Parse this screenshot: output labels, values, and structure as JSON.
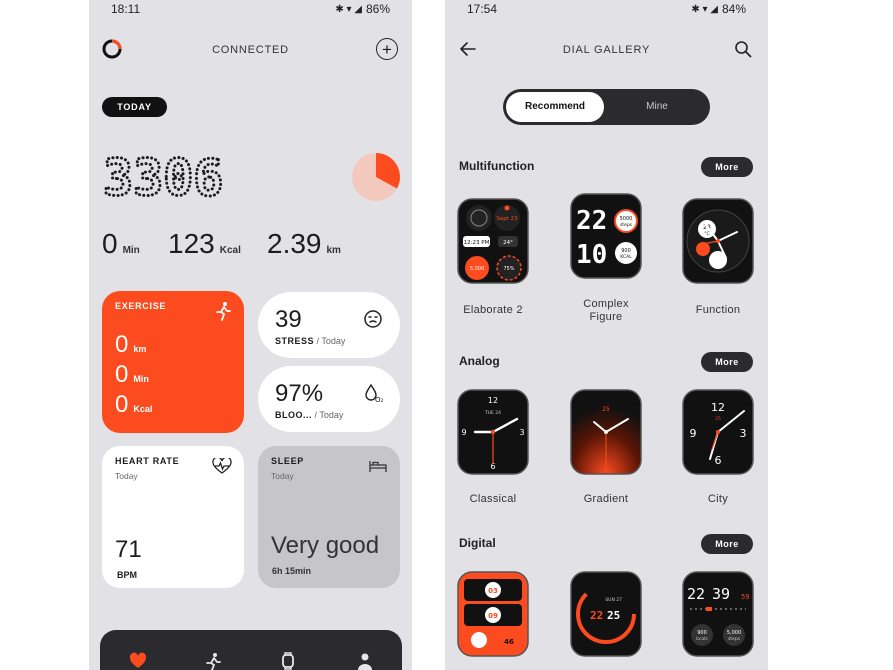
{
  "phone1": {
    "status": {
      "time": "18:11",
      "icons": "✱ ▾ ◢",
      "battery": "86%"
    },
    "header": {
      "title": "CONNECTED"
    },
    "today_chip": "TODAY",
    "steps": "3306",
    "ring_progress": 0.33,
    "metrics": [
      {
        "value": "0",
        "unit": "Min"
      },
      {
        "value": "123",
        "unit": "Kcal"
      },
      {
        "value": "2.39",
        "unit": "km"
      }
    ],
    "exercise": {
      "label": "EXERCISE",
      "rows": [
        {
          "value": "0",
          "unit": "km"
        },
        {
          "value": "0",
          "unit": "Min"
        },
        {
          "value": "0",
          "unit": "Kcal"
        }
      ]
    },
    "stress": {
      "value": "39",
      "label": "STRESS",
      "sub": "/ Today"
    },
    "blood": {
      "value": "97%",
      "label": "BLOO...",
      "sub": "/ Today"
    },
    "heart_rate": {
      "label": "HEART RATE",
      "sub": "Today",
      "value": "71",
      "unit": "BPM"
    },
    "sleep": {
      "label": "SLEEP",
      "sub": "Today",
      "value": "Very good",
      "duration": "6h 15min"
    },
    "nav": [
      "heart-icon",
      "runner-icon",
      "watch-icon",
      "person-icon"
    ],
    "colors": {
      "accent": "#fc4b1f",
      "background": "#e2e1e6",
      "dark": "#2b2b2f"
    }
  },
  "phone2": {
    "status": {
      "time": "17:54",
      "icons": "✱ ▾ ◢",
      "battery": "84%"
    },
    "header": {
      "title": "DIAL GALLERY"
    },
    "tabs": {
      "active": "Recommend",
      "inactive": "Mine"
    },
    "sections": [
      {
        "title": "Multifunction",
        "more": "More",
        "watches": [
          {
            "name": "Elaborate 2",
            "texts": [
              "12:23 PM",
              "24°",
              "5,000",
              "75%",
              "8",
              "Sept 23"
            ]
          },
          {
            "name": "Complex\nFigure",
            "texts": [
              "22",
              "10",
              "5000",
              "steps",
              "900",
              "KCAL"
            ]
          },
          {
            "name": "Function",
            "texts": [
              "28",
              "°C"
            ]
          }
        ]
      },
      {
        "title": "Analog",
        "more": "More",
        "watches": [
          {
            "name": "Classical",
            "texts": [
              "12",
              "6",
              "3",
              "9",
              "TUE 24"
            ]
          },
          {
            "name": "Gradient",
            "texts": [
              "25"
            ]
          },
          {
            "name": "City",
            "texts": [
              "12",
              "9",
              "3",
              "6",
              "25"
            ]
          }
        ]
      },
      {
        "title": "Digital",
        "more": "More",
        "watches": [
          {
            "name": "",
            "texts": [
              "03",
              "09",
              "46"
            ]
          },
          {
            "name": "",
            "texts": [
              "22",
              "25",
              "SUN 27"
            ]
          },
          {
            "name": "",
            "texts": [
              "22",
              "39",
              "59",
              "900",
              "kcals",
              "5,000",
              "steps"
            ]
          }
        ]
      }
    ]
  }
}
